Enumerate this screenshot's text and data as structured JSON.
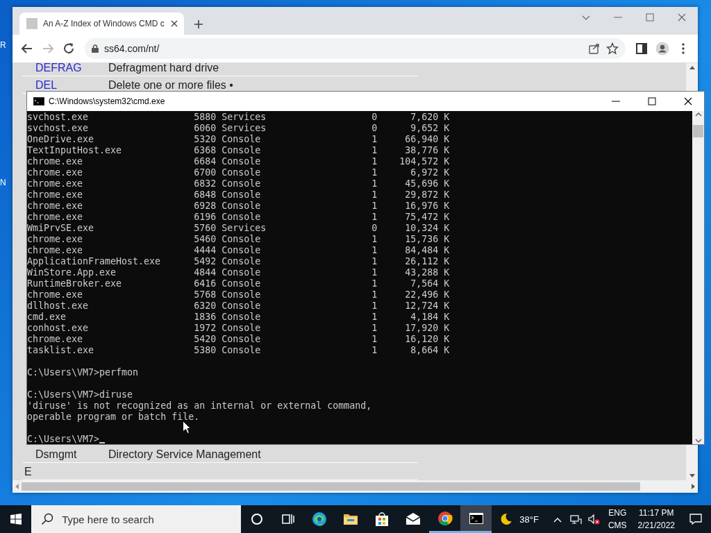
{
  "desktop": {
    "icon_labels": [
      "R",
      "N"
    ]
  },
  "browser": {
    "tab": {
      "title": "An A-Z Index of Windows CMD c",
      "selected": true
    },
    "address": "ss64.com/nt/",
    "rows_top": [
      {
        "kind": "link",
        "command": "DEFRAG",
        "description": "Defragment hard drive"
      },
      {
        "kind": "link",
        "command": "DEL",
        "description": "Delete one or more files •"
      }
    ],
    "rows_bottom": [
      {
        "kind": "plain",
        "command": "Dsmgmt",
        "description": "Directory Service Management"
      },
      {
        "kind": "heading",
        "command": "E"
      }
    ]
  },
  "console": {
    "title": "C:\\Windows\\system32\\cmd.exe",
    "processes": [
      {
        "image": "svchost.exe",
        "pid": "5880",
        "session": "Services",
        "session_num": "0",
        "memory": "7,620 K"
      },
      {
        "image": "svchost.exe",
        "pid": "6060",
        "session": "Services",
        "session_num": "0",
        "memory": "9,652 K"
      },
      {
        "image": "OneDrive.exe",
        "pid": "5320",
        "session": "Console",
        "session_num": "1",
        "memory": "66,940 K"
      },
      {
        "image": "TextInputHost.exe",
        "pid": "6368",
        "session": "Console",
        "session_num": "1",
        "memory": "38,776 K"
      },
      {
        "image": "chrome.exe",
        "pid": "6684",
        "session": "Console",
        "session_num": "1",
        "memory": "104,572 K"
      },
      {
        "image": "chrome.exe",
        "pid": "6700",
        "session": "Console",
        "session_num": "1",
        "memory": "6,972 K"
      },
      {
        "image": "chrome.exe",
        "pid": "6832",
        "session": "Console",
        "session_num": "1",
        "memory": "45,696 K"
      },
      {
        "image": "chrome.exe",
        "pid": "6848",
        "session": "Console",
        "session_num": "1",
        "memory": "29,872 K"
      },
      {
        "image": "chrome.exe",
        "pid": "6928",
        "session": "Console",
        "session_num": "1",
        "memory": "16,976 K"
      },
      {
        "image": "chrome.exe",
        "pid": "6196",
        "session": "Console",
        "session_num": "1",
        "memory": "75,472 K"
      },
      {
        "image": "WmiPrvSE.exe",
        "pid": "5760",
        "session": "Services",
        "session_num": "0",
        "memory": "10,324 K"
      },
      {
        "image": "chrome.exe",
        "pid": "5460",
        "session": "Console",
        "session_num": "1",
        "memory": "15,736 K"
      },
      {
        "image": "chrome.exe",
        "pid": "4444",
        "session": "Console",
        "session_num": "1",
        "memory": "84,484 K"
      },
      {
        "image": "ApplicationFrameHost.exe",
        "pid": "5492",
        "session": "Console",
        "session_num": "1",
        "memory": "26,112 K"
      },
      {
        "image": "WinStore.App.exe",
        "pid": "4844",
        "session": "Console",
        "session_num": "1",
        "memory": "43,288 K"
      },
      {
        "image": "RuntimeBroker.exe",
        "pid": "6416",
        "session": "Console",
        "session_num": "1",
        "memory": "7,564 K"
      },
      {
        "image": "chrome.exe",
        "pid": "5768",
        "session": "Console",
        "session_num": "1",
        "memory": "22,496 K"
      },
      {
        "image": "dllhost.exe",
        "pid": "6320",
        "session": "Console",
        "session_num": "1",
        "memory": "12,724 K"
      },
      {
        "image": "cmd.exe",
        "pid": "1836",
        "session": "Console",
        "session_num": "1",
        "memory": "4,184 K"
      },
      {
        "image": "conhost.exe",
        "pid": "1972",
        "session": "Console",
        "session_num": "1",
        "memory": "17,920 K"
      },
      {
        "image": "chrome.exe",
        "pid": "5420",
        "session": "Console",
        "session_num": "1",
        "memory": "16,120 K"
      },
      {
        "image": "tasklist.exe",
        "pid": "5380",
        "session": "Console",
        "session_num": "1",
        "memory": "8,664 K"
      }
    ],
    "lines": [
      {
        "kind": "blank"
      },
      {
        "kind": "text",
        "text": "C:\\Users\\VM7>perfmon"
      },
      {
        "kind": "blank"
      },
      {
        "kind": "text",
        "text": "C:\\Users\\VM7>diruse"
      },
      {
        "kind": "text",
        "text": "'diruse' is not recognized as an internal or external command,"
      },
      {
        "kind": "text",
        "text": "operable program or batch file."
      },
      {
        "kind": "blank"
      },
      {
        "kind": "prompt",
        "text": "C:\\Users\\VM7>"
      }
    ]
  },
  "taskbar": {
    "search_placeholder": "Type here to search",
    "apps": [
      {
        "kind": "cortana",
        "running": false,
        "selected": false
      },
      {
        "kind": "taskview",
        "running": false,
        "selected": false
      },
      {
        "kind": "edge",
        "running": false,
        "selected": false
      },
      {
        "kind": "explorer",
        "running": false,
        "selected": false
      },
      {
        "kind": "store",
        "running": false,
        "selected": false
      },
      {
        "kind": "mail",
        "running": false,
        "selected": false
      },
      {
        "kind": "chrome",
        "running": true,
        "selected": false
      },
      {
        "kind": "terminal",
        "running": true,
        "selected": true
      }
    ],
    "weather": "38°F",
    "language": [
      "ENG",
      "CMS"
    ],
    "time": "11:17 PM",
    "date": "2/21/2022"
  }
}
